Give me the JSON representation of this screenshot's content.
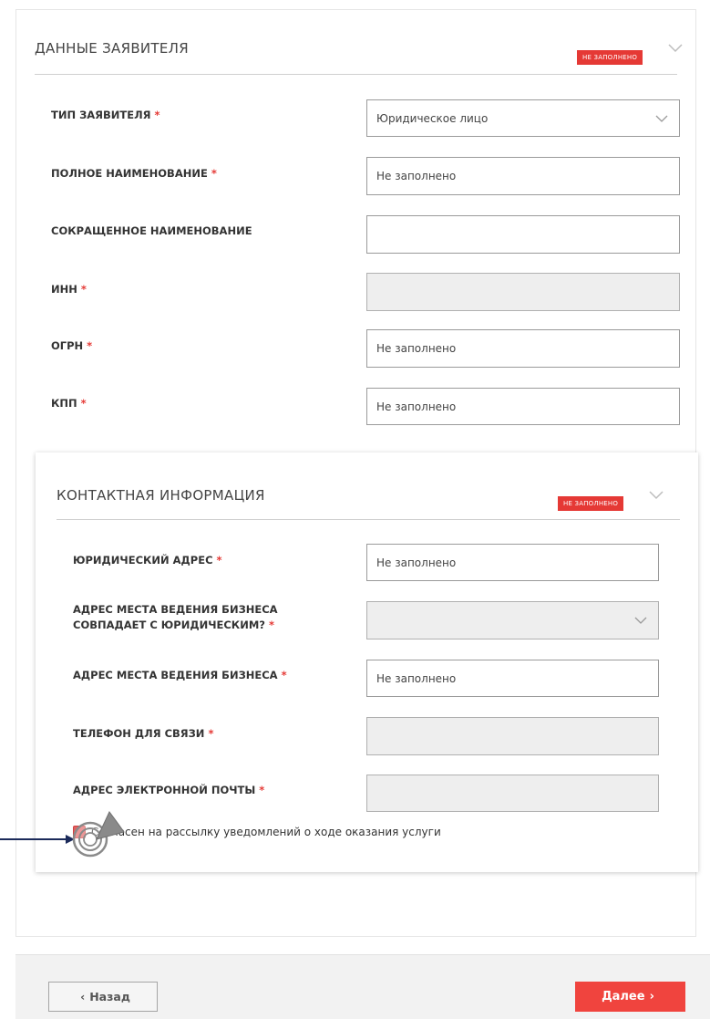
{
  "applicant_section": {
    "title": "ДАННЫЕ ЗАЯВИТЕЛЯ",
    "status": "НЕ ЗАПОЛНЕНО",
    "fields": {
      "type": {
        "label": "ТИП ЗАЯВИТЕЛЯ",
        "value": "Юридическое лицо"
      },
      "full_name": {
        "label": "ПОЛНОЕ НАИМЕНОВАНИЕ",
        "value": "Не заполнено"
      },
      "short_name": {
        "label": "СОКРАЩЕННОЕ НАИМЕНОВАНИЕ",
        "value": ""
      },
      "inn": {
        "label": "ИНН",
        "value": ""
      },
      "ogrn": {
        "label": "ОГРН",
        "value": "Не заполнено"
      },
      "kpp": {
        "label": "КПП",
        "value": "Не заполнено"
      }
    }
  },
  "contact_section": {
    "title": "КОНТАКТНАЯ ИНФОРМАЦИЯ",
    "status": "НЕ ЗАПОЛНЕНО",
    "fields": {
      "legal_address": {
        "label": "ЮРИДИЧЕСКИЙ АДРЕС",
        "value": "Не заполнено"
      },
      "same_address": {
        "label_line1": "АДРЕС МЕСТА ВЕДЕНИЯ БИЗНЕСА",
        "label_line2": "СОВПАДАЕТ С ЮРИДИЧЕСКИМ?",
        "value": ""
      },
      "business_address": {
        "label": "АДРЕС МЕСТА ВЕДЕНИЯ БИЗНЕСА",
        "value": "Не заполнено"
      },
      "phone": {
        "label": "ТЕЛЕФОН ДЛЯ СВЯЗИ",
        "value": ""
      },
      "email": {
        "label": "АДРЕС ЭЛЕКТРОННОЙ ПОЧТЫ",
        "value": ""
      }
    },
    "consent": {
      "label": "Согласен на рассылку уведомлений о ходе оказания услуги",
      "checked": true
    }
  },
  "required_mark": "*",
  "footer": {
    "back_label": "Назад",
    "back_arrow": "‹",
    "next_label": "Далее",
    "next_arrow": "›"
  },
  "colors": {
    "accent": "#f0443e",
    "badge": "#e53935",
    "pointer": "#1b2a5a"
  }
}
